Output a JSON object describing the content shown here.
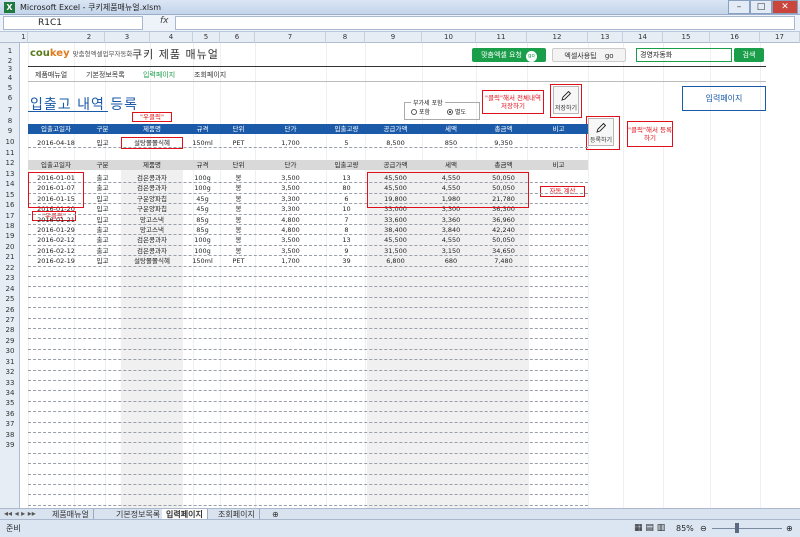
{
  "window": {
    "title": "Microsoft Excel - 쿠키제품매뉴얼.xlsm",
    "app_icon": "X"
  },
  "formula_bar": {
    "name_box": "R1C1",
    "fx": "fx"
  },
  "columns": [
    "1",
    "2",
    "3",
    "4",
    "5",
    "6",
    "7",
    "8",
    "9",
    "10",
    "11",
    "12",
    "13",
    "14",
    "15",
    "16",
    "17"
  ],
  "rows": [
    "1",
    "2",
    "3",
    "4",
    "5",
    "6",
    "7",
    "8",
    "9",
    "10",
    "11",
    "12",
    "13",
    "14",
    "15",
    "16",
    "17",
    "18",
    "19",
    "20",
    "21",
    "22",
    "23",
    "24",
    "25",
    "26",
    "27",
    "28",
    "29",
    "30",
    "31",
    "32",
    "33",
    "34",
    "35",
    "36",
    "37",
    "38",
    "39"
  ],
  "header": {
    "brand": "coukey",
    "brand_accent": "key",
    "tagline": "맞춤형엑셀업무자동화",
    "menu_title": "쿠키 제품 매뉴얼",
    "btn_custom": "맞춤엑셀 요청",
    "btn_tips": "엑셀사용팁",
    "go": "go",
    "search_value": "경영자동화",
    "search_btn": "검색"
  },
  "nav": [
    "제품매뉴얼",
    "기본정보목록",
    "입력페이지",
    "조회페이지"
  ],
  "page_title": "입출고 내역 등록",
  "callouts": {
    "right_click_top": "\"우클릭\"",
    "right_click_left": "\"우클릭\"",
    "save_hint": "\"클릭\"해서 전체내역 저장하기",
    "reg_hint": "\"클릭\"해서 등록하기",
    "auto_calc": "자동 계산"
  },
  "buttons": {
    "save": "저장하기",
    "register": "등록하기",
    "input_page": "입력페이지"
  },
  "radio": {
    "legend": "부가세 포함",
    "opt1": "포함",
    "opt2": "별도"
  },
  "table_headers": [
    "입출고일자",
    "구분",
    "제품명",
    "규격",
    "단위",
    "단가",
    "입출고량",
    "공급가액",
    "세액",
    "총금액",
    "비고"
  ],
  "entry_row": [
    "2016-04-18",
    "입고",
    "설탕쫄쫄식혜",
    "150ml",
    "PET",
    "1,700",
    "5",
    "8,500",
    "850",
    "9,350",
    ""
  ],
  "list_rows": [
    [
      "2016-01-01",
      "출고",
      "검은콩과자",
      "100g",
      "봉",
      "3,500",
      "13",
      "45,500",
      "4,550",
      "50,050",
      ""
    ],
    [
      "2016-01-07",
      "출고",
      "검은콩과자",
      "100g",
      "봉",
      "3,500",
      "80",
      "45,500",
      "4,550",
      "50,050",
      ""
    ],
    [
      "2016-01-15",
      "입고",
      "구운양파칩",
      "45g",
      "봉",
      "3,300",
      "6",
      "19,800",
      "1,980",
      "21,780",
      ""
    ],
    [
      "2016-01-20",
      "입고",
      "구운양파칩",
      "45g",
      "봉",
      "3,300",
      "10",
      "33,000",
      "3,300",
      "36,300",
      ""
    ],
    [
      "2016-01-21",
      "입고",
      "망고스낵",
      "85g",
      "봉",
      "4,800",
      "7",
      "33,600",
      "3,360",
      "36,960",
      ""
    ],
    [
      "2016-01-29",
      "출고",
      "망고스낵",
      "85g",
      "봉",
      "4,800",
      "8",
      "38,400",
      "3,840",
      "42,240",
      ""
    ],
    [
      "2016-02-12",
      "출고",
      "검은콩과자",
      "100g",
      "봉",
      "3,500",
      "13",
      "45,500",
      "4,550",
      "50,050",
      ""
    ],
    [
      "2016-02-12",
      "출고",
      "검은콩과자",
      "100g",
      "봉",
      "3,500",
      "9",
      "31,500",
      "3,150",
      "34,650",
      ""
    ],
    [
      "2016-02-19",
      "입고",
      "설탕쫄쫄식혜",
      "150ml",
      "PET",
      "1,700",
      "39",
      "6,800",
      "680",
      "7,480",
      ""
    ]
  ],
  "sheet_tabs": [
    "제품매뉴얼",
    "기본정보목록",
    "입력페이지",
    "조회페이지"
  ],
  "status": {
    "ready": "준비",
    "zoom": "85%"
  }
}
